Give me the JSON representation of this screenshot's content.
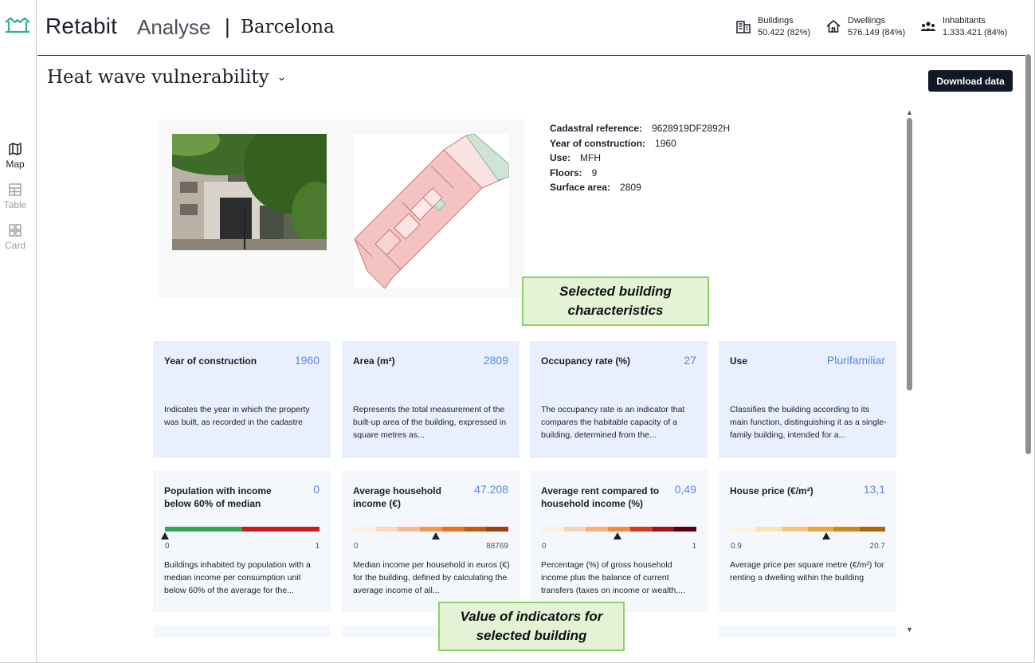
{
  "brand": {
    "name": "Retabit",
    "product": "Analyse",
    "separator": "|",
    "city": "Barcelona"
  },
  "nav": [
    {
      "label": "Map",
      "icon": "map-icon",
      "active": true
    },
    {
      "label": "Table",
      "icon": "table-icon",
      "active": false
    },
    {
      "label": "Card",
      "icon": "grid-icon",
      "active": false
    }
  ],
  "stats": [
    {
      "label": "Buildings",
      "value": "50.422 (82%)",
      "icon": "building-icon"
    },
    {
      "label": "Dwellings",
      "value": "576.149 (84%)",
      "icon": "house-icon"
    },
    {
      "label": "Inhabitants",
      "value": "1.333.421 (84%)",
      "icon": "people-icon"
    }
  ],
  "page": {
    "title": "Heat wave vulnerability",
    "download_label": "Download data"
  },
  "building": {
    "cadastral_label": "Cadastral reference:",
    "cadastral_value": "9628919DF2892H",
    "year_label": "Year of construction:",
    "year_value": "1960",
    "use_label": "Use:",
    "use_value": "MFH",
    "floors_label": "Floors:",
    "floors_value": "9",
    "surface_label": "Surface area:",
    "surface_value": "2809"
  },
  "callouts": {
    "characteristics": "Selected building characteristics",
    "indicators": "Value of indicators for selected building"
  },
  "cards_row1": [
    {
      "title": "Year of construction",
      "value": "1960",
      "desc": "Indicates the year in which the property was built, as recorded in the cadastre"
    },
    {
      "title": "Area (m²)",
      "value": "2809",
      "desc": "Represents the total measurement of the built-up area of the building, expressed in square metres as..."
    },
    {
      "title": "Occupancy rate (%)",
      "value": "27",
      "desc": "The occupancy rate is an indicator that compares the habitable capacity of a building, determined from the..."
    },
    {
      "title": "Use",
      "value": "Plurifamiliar",
      "desc": "Classifies the building according to its main function, distinguishing it as a single-family building, intended for a..."
    }
  ],
  "cards_row2": [
    {
      "title": "Population with income below 60% of median",
      "value": "0",
      "min": "0",
      "max": "1",
      "marker_fraction": 0.0,
      "scale": [
        "#33a852",
        "#33a852",
        "#d11a1a",
        "#d11a1a"
      ],
      "desc": "Buildings inhabited by population with a median income per consumption unit below 60% of the average for the..."
    },
    {
      "title": "Average household income (€)",
      "value": "47.208",
      "min": "0",
      "max": "88769",
      "marker_fraction": 0.53,
      "scale": [
        "#fdeee2",
        "#fcd9bd",
        "#f8b98c",
        "#f29650",
        "#e9741e",
        "#c85a10",
        "#9b4208"
      ],
      "desc": "Median income per household in euros (€) for the building, defined by calculating the average income of all..."
    },
    {
      "title": "Average rent compared to household income (%)",
      "value": "0,49",
      "min": "0",
      "max": "1",
      "marker_fraction": 0.49,
      "scale": [
        "#fdeee2",
        "#fcd3b0",
        "#f8b07a",
        "#f08a40",
        "#d93a1c",
        "#a8101a",
        "#5c0010"
      ],
      "desc": "Percentage (%) of gross household income plus the balance of current transfers (taxes on income or wealth,..."
    },
    {
      "title": "House price (€/m²)",
      "value": "13,1",
      "min": "0.9",
      "max": "20.7",
      "marker_fraction": 0.62,
      "scale": [
        "#fff2dc",
        "#fde1b0",
        "#f8c478",
        "#eca840",
        "#d18a18",
        "#a66a08"
      ],
      "desc": "Average price per square metre (€/m²) for renting a dwelling within the building"
    }
  ]
}
